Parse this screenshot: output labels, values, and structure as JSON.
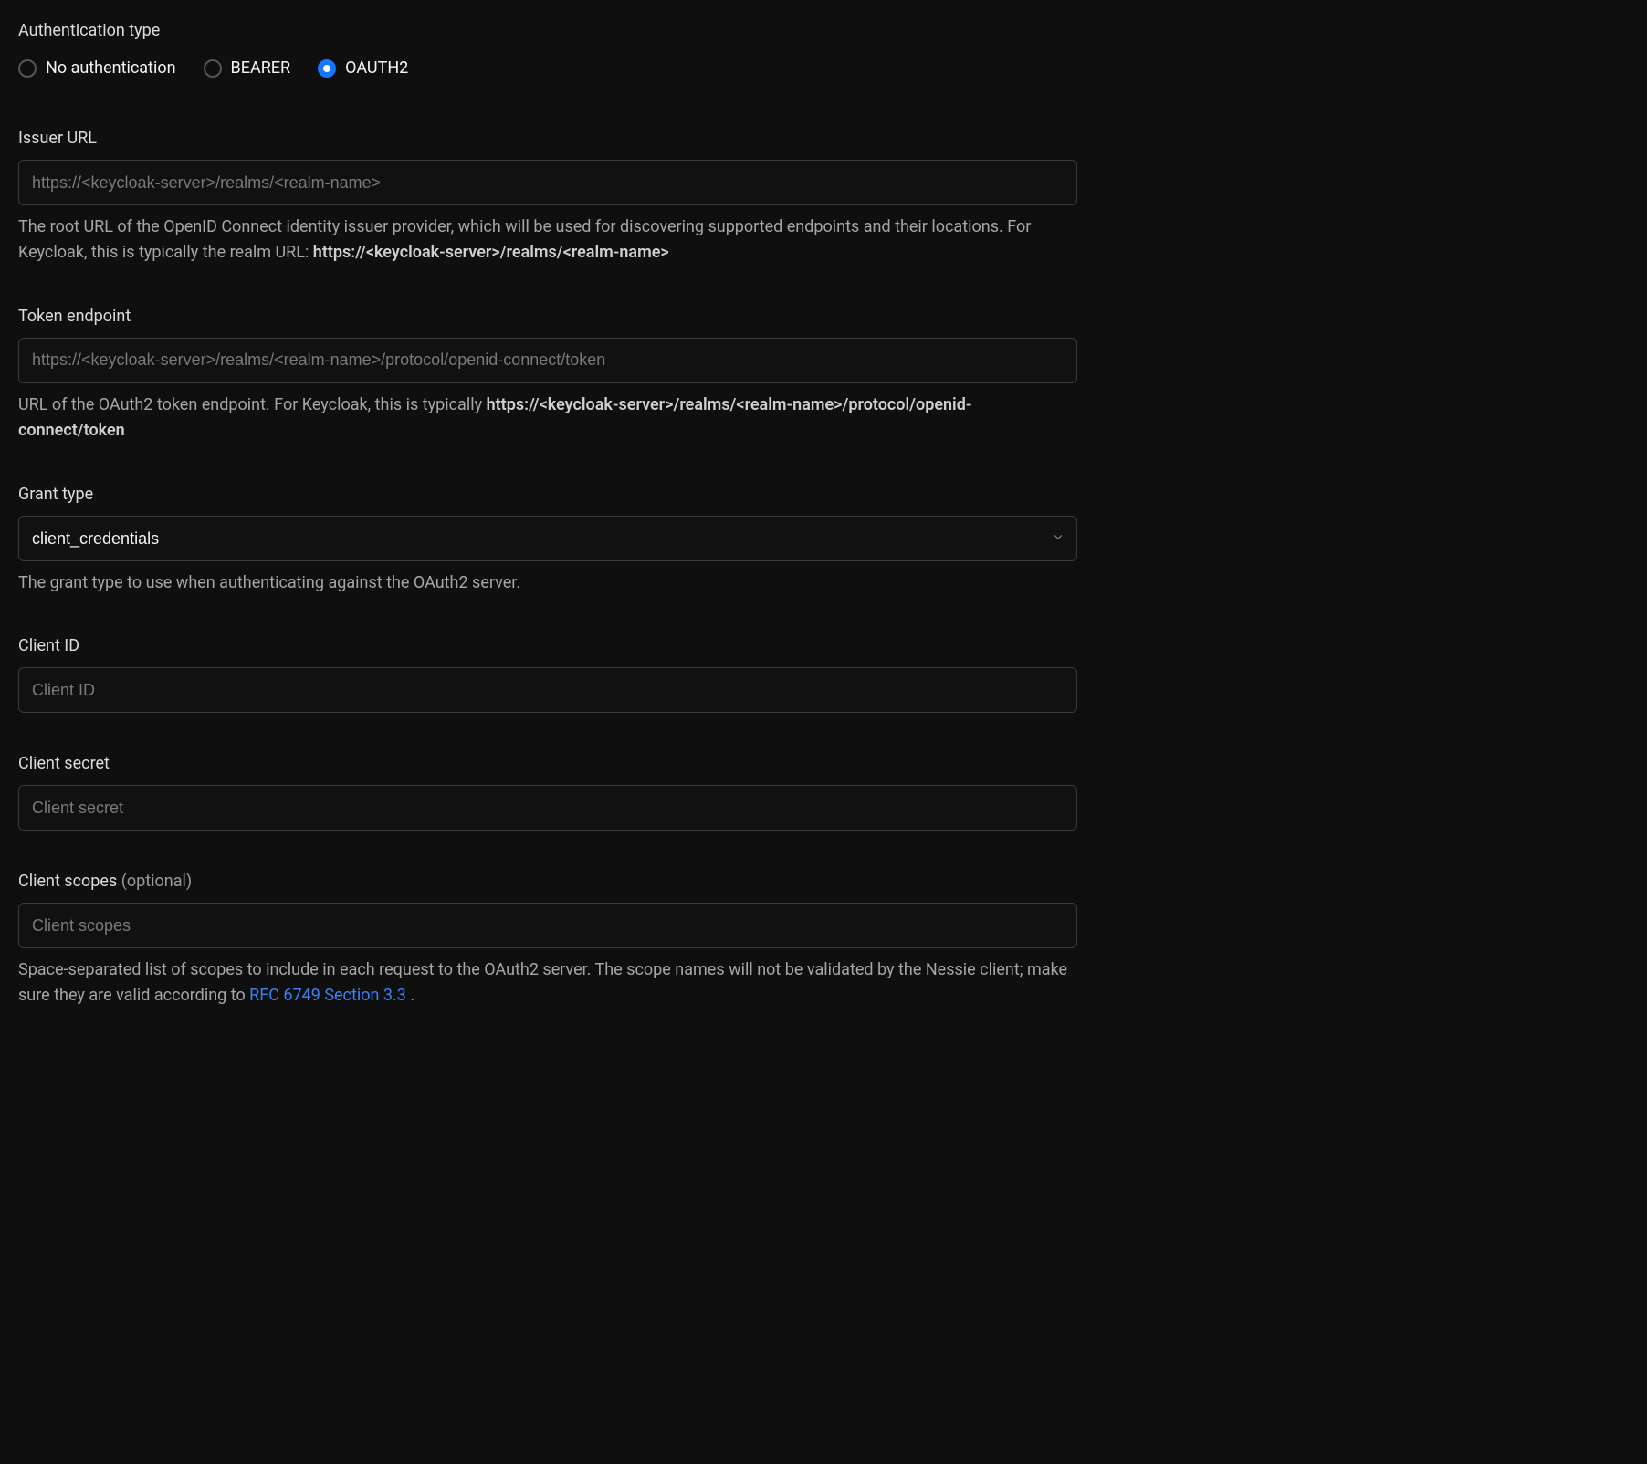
{
  "auth_type": {
    "label": "Authentication type",
    "options": {
      "none": "No authentication",
      "bearer": "BEARER",
      "oauth2": "OAUTH2"
    },
    "selected": "oauth2"
  },
  "issuer": {
    "label": "Issuer URL",
    "placeholder": "https://<keycloak-server>/realms/<realm-name>",
    "value": "",
    "help_pre": "The root URL of the OpenID Connect identity issuer provider, which will be used for discovering supported endpoints and their locations. For Keycloak, this is typically the realm URL: ",
    "help_bold": "https://<keycloak-server>/realms/<realm-name>"
  },
  "token_endpoint": {
    "label": "Token endpoint",
    "placeholder": "https://<keycloak-server>/realms/<realm-name>/protocol/openid-connect/token",
    "value": "",
    "help_pre": "URL of the OAuth2 token endpoint. For Keycloak, this is typically ",
    "help_bold": "https://<keycloak-server>/realms/<realm-name>/protocol/openid-connect/token"
  },
  "grant_type": {
    "label": "Grant type",
    "selected": "client_credentials",
    "help": "The grant type to use when authenticating against the OAuth2 server."
  },
  "client_id": {
    "label": "Client ID",
    "placeholder": "Client ID",
    "value": ""
  },
  "client_secret": {
    "label": "Client secret",
    "placeholder": "Client secret",
    "value": ""
  },
  "client_scopes": {
    "label": "Client scopes",
    "optional": " (optional)",
    "placeholder": "Client scopes",
    "value": "",
    "help_pre": "Space-separated list of scopes to include in each request to the OAuth2 server. The scope names will not be validated by the Nessie client; make sure they are valid according to ",
    "help_link_text": "RFC 6749 Section 3.3",
    "help_post": " ."
  }
}
